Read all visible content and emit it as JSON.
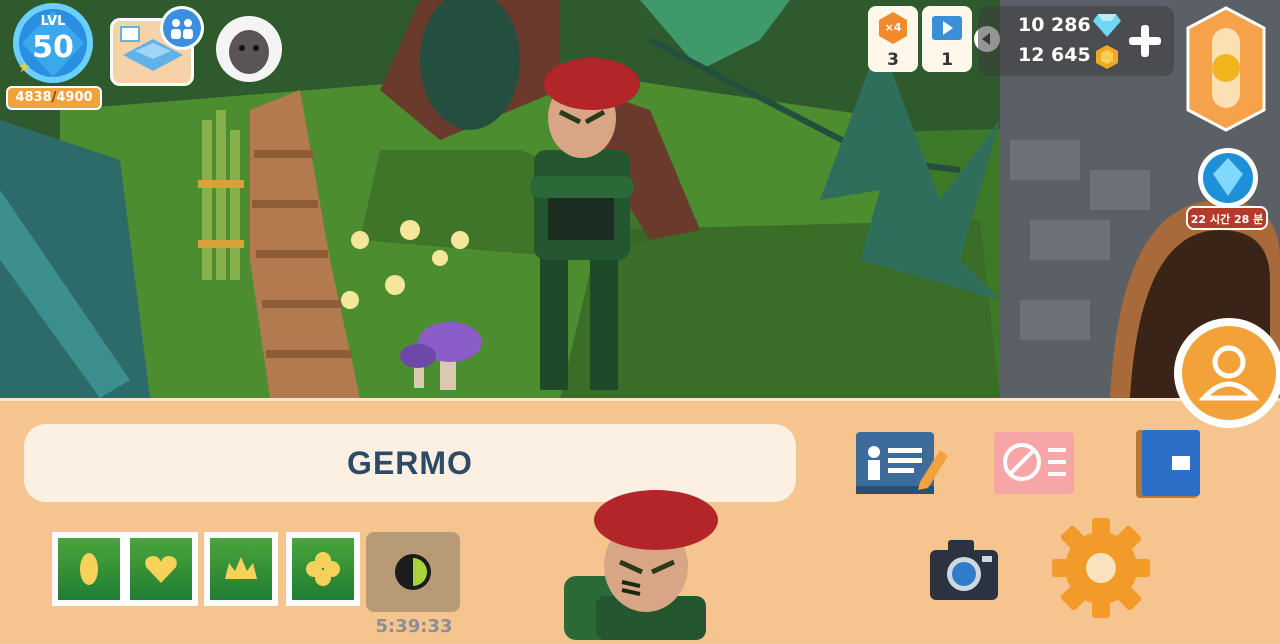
{
  "player": {
    "level_label": "LVL",
    "level": "50",
    "xp_current": "4838",
    "xp_max": "4900"
  },
  "boosters": [
    {
      "icon": "xp-multiplier-icon",
      "badge": "×4",
      "count": "3"
    },
    {
      "icon": "video-ticket-icon",
      "count": "1"
    }
  ],
  "currency": {
    "gems": "10 286",
    "coins": "12 645"
  },
  "event": {
    "timer": "22 시간 28 분"
  },
  "profile": {
    "name": "GERMO"
  },
  "stamps": {
    "icons": [
      "leaf-icon",
      "heart-icon",
      "crown-icon",
      "clover-icon"
    ],
    "locked_icon": "half-moon-icon",
    "timer": "5:39:33"
  },
  "colors": {
    "panel": "#f6c48f",
    "accent_orange": "#f2a23a",
    "name_text": "#2d4a66"
  }
}
